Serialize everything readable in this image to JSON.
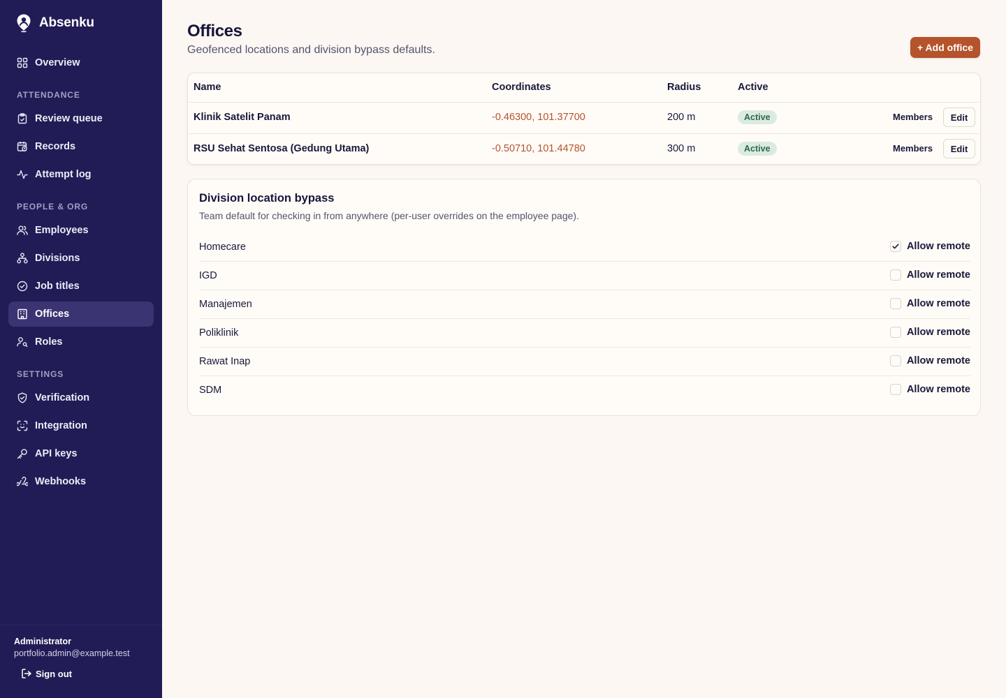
{
  "app": {
    "name": "Absenku"
  },
  "sidebar": {
    "overview": "Overview",
    "sections": {
      "attendance": "ATTENDANCE",
      "people": "PEOPLE & ORG",
      "settings": "SETTINGS"
    },
    "items": {
      "review_queue": "Review queue",
      "records": "Records",
      "attempt_log": "Attempt log",
      "employees": "Employees",
      "divisions": "Divisions",
      "job_titles": "Job titles",
      "offices": "Offices",
      "roles": "Roles",
      "verification": "Verification",
      "integration": "Integration",
      "api_keys": "API keys",
      "webhooks": "Webhooks"
    },
    "active_item": "offices",
    "user": {
      "name": "Administrator",
      "email": "portfolio.admin@example.test",
      "signout": "Sign out"
    }
  },
  "page": {
    "title": "Offices",
    "subtitle": "Geofenced locations and division bypass defaults.",
    "add_button": "+ Add office"
  },
  "offices_table": {
    "columns": [
      "Name",
      "Coordinates",
      "Radius",
      "Active"
    ],
    "rows": [
      {
        "name": "Klinik Satelit Panam",
        "coordinates": "-0.46300, 101.37700",
        "radius": "200 m",
        "active": "Active",
        "members": "Members",
        "edit": "Edit"
      },
      {
        "name": "RSU Sehat Sentosa (Gedung Utama)",
        "coordinates": "-0.50710, 101.44780",
        "radius": "300 m",
        "active": "Active",
        "members": "Members",
        "edit": "Edit"
      }
    ]
  },
  "bypass": {
    "title": "Division location bypass",
    "description": "Team default for checking in from anywhere (per-user overrides on the employee page).",
    "checkbox_label": "Allow remote",
    "divisions": [
      {
        "name": "Homecare",
        "allow_remote": true
      },
      {
        "name": "IGD",
        "allow_remote": false
      },
      {
        "name": "Manajemen",
        "allow_remote": false
      },
      {
        "name": "Poliklinik",
        "allow_remote": false
      },
      {
        "name": "Rawat Inap",
        "allow_remote": false
      },
      {
        "name": "SDM",
        "allow_remote": false
      }
    ]
  },
  "colors": {
    "sidebar_bg": "#211c55",
    "sidebar_active": "#3a3472",
    "accent": "#b5532b",
    "page_bg": "#fcf7f2",
    "badge_bg": "#dcebe1",
    "badge_text": "#2d6a47"
  }
}
